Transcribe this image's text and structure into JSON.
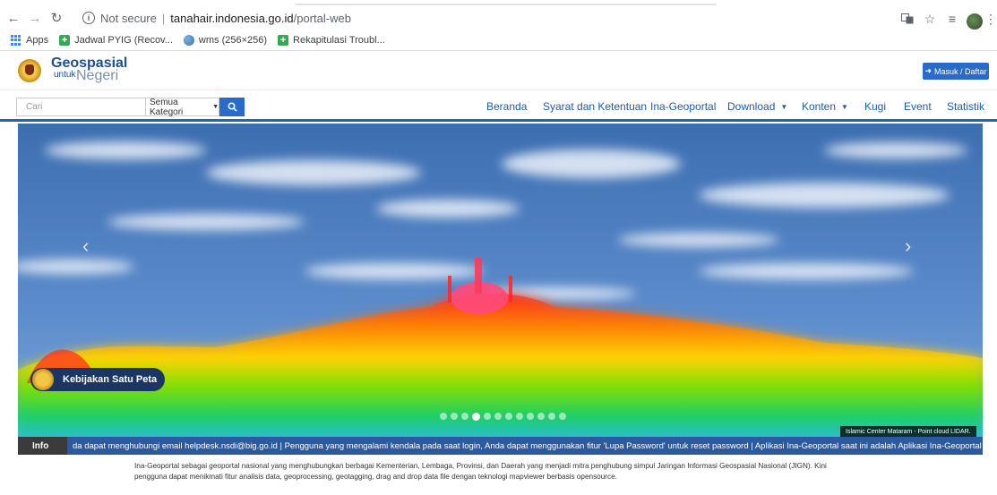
{
  "browser": {
    "url_status": "Not secure",
    "url_host": "tanahair.indonesia.go.id",
    "url_path": "/portal-web",
    "bookmarks": [
      {
        "label": "Apps",
        "icon": "apps-icon"
      },
      {
        "label": "Jadwal PYIG (Recov...",
        "icon": "sheets-icon"
      },
      {
        "label": "wms (256×256)",
        "icon": "globe-icon"
      },
      {
        "label": "Rekapitulasi Troubl...",
        "icon": "sheets-icon"
      }
    ]
  },
  "header": {
    "brand_line1": "Geospasial",
    "brand_line2_small": "untuk",
    "brand_line2_large": "Negeri",
    "login_button": "Masuk / Daftar",
    "accent_color": "#2a6bc9"
  },
  "navbar": {
    "search_placeholder": "Cari",
    "category_select": "Semua Kategori",
    "items": [
      {
        "label": "Beranda",
        "dropdown": false
      },
      {
        "label": "Syarat dan Ketentuan",
        "dropdown": false
      },
      {
        "label": "Ina-Geoportal",
        "dropdown": false
      },
      {
        "label": "Download",
        "dropdown": true
      },
      {
        "label": "Konten",
        "dropdown": true
      },
      {
        "label": "Kugi",
        "dropdown": false
      },
      {
        "label": "Event",
        "dropdown": false
      },
      {
        "label": "Statistik",
        "dropdown": false
      }
    ]
  },
  "carousel": {
    "badge_text": "Kebijakan Satu Peta",
    "caption": "Islamic Center Mataram - Point cloud LIDAR.",
    "slide_count": 12,
    "active_slide": 4
  },
  "ticker": {
    "label": "Info",
    "text": "da dapat menghubungi email helpdesk.nsdi@big.go.id    |    Pengguna yang mengalami kendala pada saat login, Anda dapat menggunakan fitur 'Lupa Password' untuk reset password    |    Aplikasi Ina-Geoportal saat ini adalah Aplikasi Ina-Geoportal"
  },
  "description": "Ina-Geoportal sebagai geoportal nasional yang menghubungkan berbagai Kementerian, Lembaga, Provinsi, dan Daerah yang menjadi mitra penghubung simpul Jaringan Informasi Geospasial Nasional (JIGN). Kini pengguna dapat menikmati fitur analisis data, geoprocessing, geotagging, drag and drop data file dengan teknologi mapviewer berbasis opensource."
}
